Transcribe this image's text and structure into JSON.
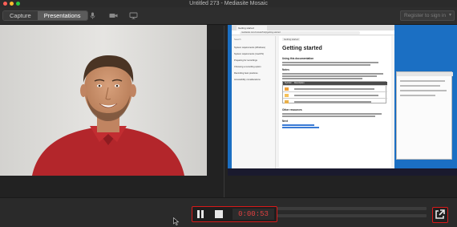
{
  "window": {
    "title": "Untitled 273 - Mediasite Mosaic"
  },
  "toolbar": {
    "tabs": [
      {
        "label": "Capture",
        "active": false
      },
      {
        "label": "Presentations",
        "active": true
      }
    ],
    "icons": [
      "microphone-icon",
      "camera-icon",
      "monitor-icon"
    ],
    "register_label": "Register to sign in"
  },
  "recording": {
    "timer": "0:00:53",
    "accent": "#d91a1a"
  },
  "screen_share": {
    "browser_tab": "Getting started",
    "url": "mediasite.com/mosaic/help/getting-started",
    "search_placeholder": "Search",
    "nav_items": [
      "System requirements (Windows)",
      "System requirements (macOS)",
      "Preparing for recordings",
      "Choosing a recording option",
      "Recording best practices",
      "Accessibility considerations"
    ],
    "breadcrumb": "Getting started",
    "doc_title": "Getting started",
    "section_1": "Using this documentation",
    "section_2": "Notes",
    "table_header_1": "Symbol",
    "table_header_2": "Description",
    "section_3": "Other resources",
    "section_4": "Next"
  }
}
